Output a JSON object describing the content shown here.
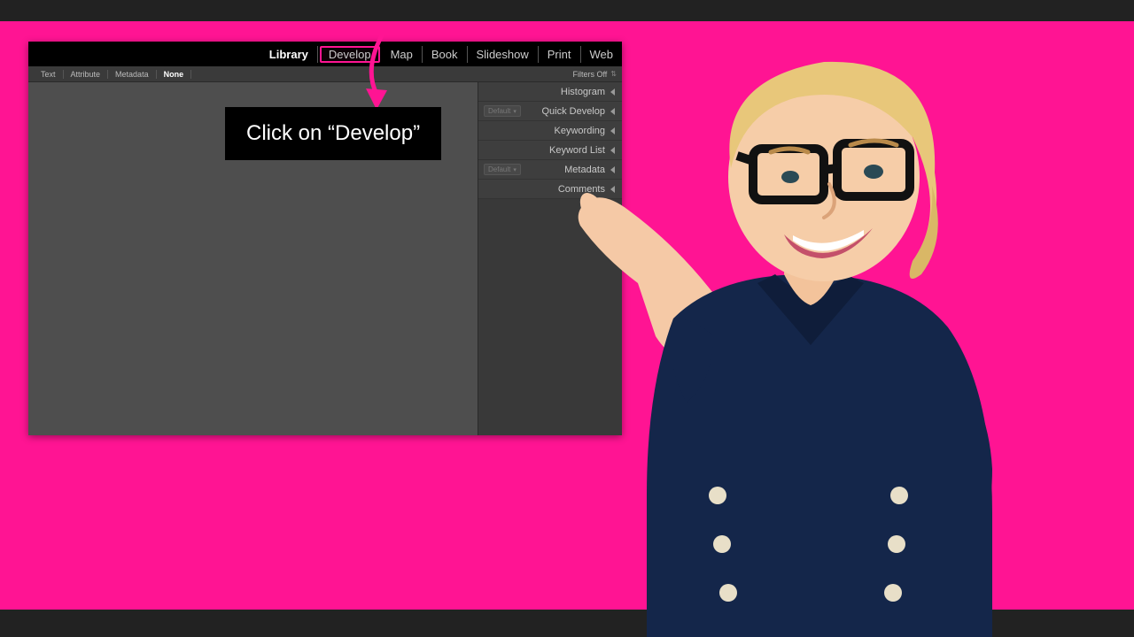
{
  "modules": {
    "library": "Library",
    "develop": "Develop",
    "map": "Map",
    "book": "Book",
    "slideshow": "Slideshow",
    "print": "Print",
    "web": "Web"
  },
  "filter_bar": {
    "text": "Text",
    "attribute": "Attribute",
    "metadata": "Metadata",
    "none": "None",
    "filters_off": "Filters Off"
  },
  "panels": {
    "histogram": "Histogram",
    "quick_develop": "Quick Develop",
    "keywording": "Keywording",
    "keyword_list": "Keyword List",
    "metadata": "Metadata",
    "comments": "Comments",
    "default_label": "Default"
  },
  "callout": "Click on “Develop”",
  "colors": {
    "accent": "#ff1493",
    "bg_dark": "#222222"
  }
}
